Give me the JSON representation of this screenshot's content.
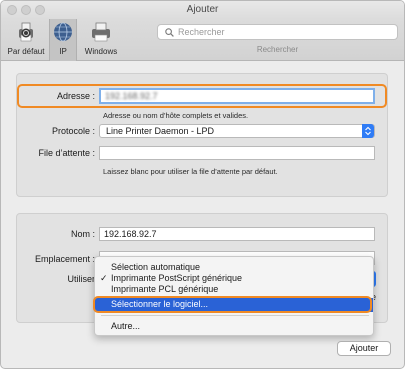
{
  "window": {
    "title": "Ajouter"
  },
  "toolbar": {
    "items": [
      {
        "label": "Par défaut",
        "icon": "default-printer-icon"
      },
      {
        "label": "IP",
        "icon": "globe-icon"
      },
      {
        "label": "Windows",
        "icon": "windows-printer-icon"
      }
    ],
    "selected": "IP"
  },
  "search": {
    "placeholder": "Rechercher",
    "label": "Rechercher"
  },
  "form": {
    "address": {
      "label": "Adresse :",
      "value": "192.168.92.7",
      "hint": "Adresse ou nom d’hôte complets et valides."
    },
    "protocol": {
      "label": "Protocole :",
      "value": "Line Printer Daemon - LPD"
    },
    "queue": {
      "label": "File d’attente :",
      "value": "",
      "hint": "Laissez blanc pour utiliser la file d’attente par défaut."
    },
    "name": {
      "label": "Nom :",
      "value": "192.168.92.7"
    },
    "location": {
      "label": "Emplacement :"
    },
    "use": {
      "label": "Utiliser"
    },
    "stub_letter": "e"
  },
  "menu": {
    "items": [
      {
        "label": "Sélection automatique",
        "checked": false
      },
      {
        "label": "Imprimante PostScript générique",
        "checked": true,
        "check_glyph": "✓"
      },
      {
        "label": "Imprimante PCL générique",
        "checked": false
      },
      {
        "label": "Sélectionner le logiciel...",
        "checked": false,
        "highlighted": true
      },
      {
        "label": "Autre...",
        "checked": false
      }
    ]
  },
  "buttons": {
    "add": "Ajouter"
  },
  "colors": {
    "accent": "#2f7cf6",
    "highlight": "#f08a24",
    "menu_selection": "#2a62d6"
  }
}
